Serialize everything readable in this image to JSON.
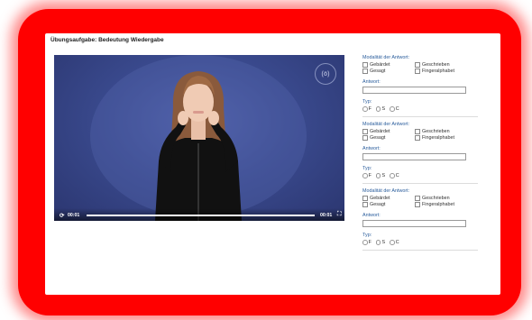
{
  "page": {
    "title": "Übungsaufgabe: Bedeutung Wiedergabe"
  },
  "video": {
    "logo_text": "(ö)",
    "current_time": "00:01",
    "duration": "00:01",
    "progress_fraction": 1.0
  },
  "panel": {
    "blocks": [
      {
        "modality_label": "Modalität der Antwort:",
        "options": [
          "Gebärdet",
          "Geschrieben",
          "Gesagt",
          "Fingeralphabet"
        ],
        "answer_label": "Antwort:",
        "answer_value": "",
        "type_label": "Typ:",
        "type_options": [
          "F",
          "S",
          "C"
        ]
      },
      {
        "modality_label": "Modalität der Antwort:",
        "options": [
          "Gebärdet",
          "Geschrieben",
          "Gesagt",
          "Fingeralphabet"
        ],
        "answer_label": "Antwort:",
        "answer_value": "",
        "type_label": "Typ:",
        "type_options": [
          "F",
          "S",
          "C"
        ]
      },
      {
        "modality_label": "Modalität der Antwort:",
        "options": [
          "Gebärdet",
          "Geschrieben",
          "Gesagt",
          "Fingeralphabet"
        ],
        "answer_label": "Antwort:",
        "answer_value": "",
        "type_label": "Typ:",
        "type_options": [
          "F",
          "S",
          "C"
        ]
      }
    ]
  },
  "colors": {
    "frame": "#ff0000",
    "label_blue": "#2a5d9c",
    "video_bg": "#3a4a8e"
  }
}
